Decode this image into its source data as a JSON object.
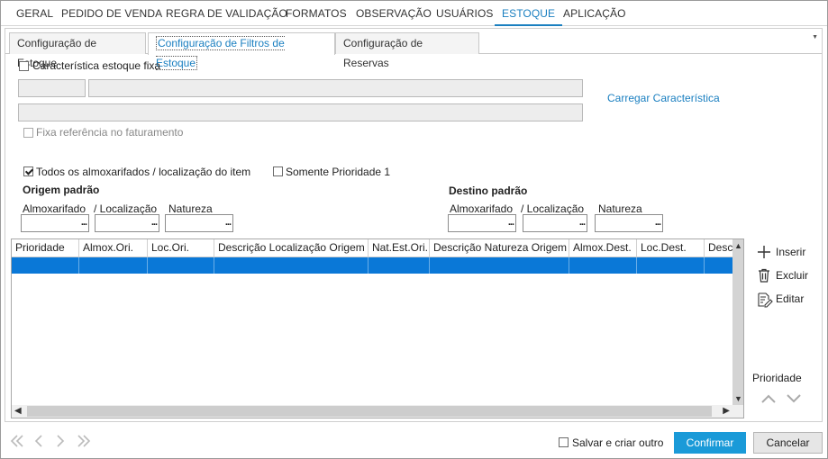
{
  "main_tabs": [
    "GERAL",
    "PEDIDO DE VENDA",
    "REGRA DE VALIDAÇÃO",
    "FORMATOS",
    "OBSERVAÇÃO",
    "USUÁRIOS",
    "ESTOQUE",
    "APLICAÇÃO"
  ],
  "active_main_tab": "ESTOQUE",
  "sub_tabs": [
    "Configuração de Estoque",
    "Configuração de Filtros de Estoque",
    "Configuração de Reservas"
  ],
  "active_sub_tab": "Configuração de Filtros de Estoque",
  "caracteristica": {
    "label": "Característica estoque fixa",
    "checked": false,
    "carregar_link": "Carregar Característica",
    "fixa_ref_label": "Fixa referência no faturamento"
  },
  "filters": {
    "todos_label": "Todos os almoxarifados / localização do item",
    "todos_checked": true,
    "somente_label": "Somente Prioridade 1",
    "somente_checked": false
  },
  "origem": {
    "title": "Origem padrão",
    "almox_label": "Almoxarifado",
    "local_label": "/ Localização",
    "natureza_label": "Natureza",
    "lookup_button": "..."
  },
  "destino": {
    "title": "Destino padrão",
    "almox_label": "Almoxarifado",
    "local_label": "/ Localização",
    "natureza_label": "Natureza",
    "lookup_button": "..."
  },
  "grid": {
    "columns": [
      "Prioridade",
      "Almox.Ori.",
      "Loc.Ori.",
      "Descrição Localização Origem",
      "Nat.Est.Ori.",
      "Descrição Natureza Origem",
      "Almox.Dest.",
      "Loc.Dest.",
      "Desc"
    ]
  },
  "side_actions": {
    "inserir": "Inserir",
    "excluir": "Excluir",
    "editar": "Editar",
    "prioridade": "Prioridade"
  },
  "footer": {
    "salvar_label": "Salvar e criar outro",
    "salvar_checked": false,
    "confirmar": "Confirmar",
    "cancelar": "Cancelar"
  },
  "colors": {
    "accent": "#1a7fc0",
    "selected_row": "#0a78d7",
    "primary_button": "#1a9ad8"
  }
}
